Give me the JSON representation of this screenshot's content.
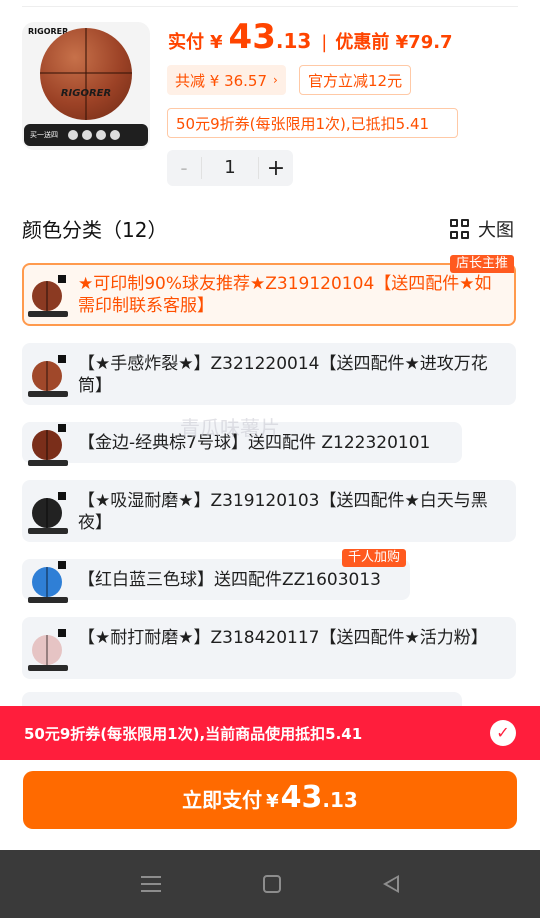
{
  "product": {
    "image_brand": "RIGORER",
    "image_logo": "RIGORER",
    "image_strip": "买一送四"
  },
  "price": {
    "label": "实付",
    "currency": "¥",
    "integer": "43",
    "decimal": ".13",
    "separator": "|",
    "original_label": "优惠前 ¥79.7"
  },
  "discounts": {
    "total": "共减 ¥ 36.57",
    "total_arrow": "›",
    "official": "官方立减12元",
    "coupon": "50元9折券(每张限用1次),已抵扣5.41"
  },
  "quantity": {
    "minus": "-",
    "value": "1",
    "plus": "+"
  },
  "section": {
    "title": "颜色分类（12）",
    "big_view": "大图"
  },
  "variants": [
    {
      "text": "★可印制90%球友推荐★Z319120104【送四配件★如需印制联系客服】",
      "badge": "店长主推",
      "ball_color": "#8b3a22",
      "selected": true
    },
    {
      "text": "【★手感炸裂★】Z321220014【送四配件★进攻万花筒】",
      "ball_color": "#a0482a",
      "selected": false
    },
    {
      "text": "【金边-经典棕7号球】送四配件 Z122320101",
      "ball_color": "#7a2e1a",
      "selected": false
    },
    {
      "text": "【★吸湿耐磨★】Z319120103【送四配件★白天与黑夜】",
      "ball_color": "#222222",
      "selected": false
    },
    {
      "text": "【红白蓝三色球】送四配件ZZ1603013",
      "badge": "千人加购",
      "ball_color": "#2f7fd6",
      "selected": false
    },
    {
      "text": "【★耐打耐磨★】Z318420117【送四配件★活力粉】",
      "ball_color": "#e6c4c4",
      "selected": false
    }
  ],
  "watermark": "青瓜味薯片",
  "coupon_bar": {
    "text": "50元9折券(每张限用1次),当前商品使用抵扣5.41",
    "check": "✓"
  },
  "pay_button": {
    "label": "立即支付",
    "currency": "¥",
    "integer": "43",
    "decimal": ".13"
  },
  "colors": {
    "accent": "#ff5000",
    "coupon_bar": "#ff1e3c",
    "pay_button": "#ff6a00",
    "badge": "#ff5a1f",
    "navbar": "#3a3a3a"
  },
  "icons": {
    "grid": "grid-icon",
    "check": "check-icon",
    "nav_menu": "menu-icon",
    "nav_home": "home-icon",
    "nav_back": "back-icon"
  }
}
